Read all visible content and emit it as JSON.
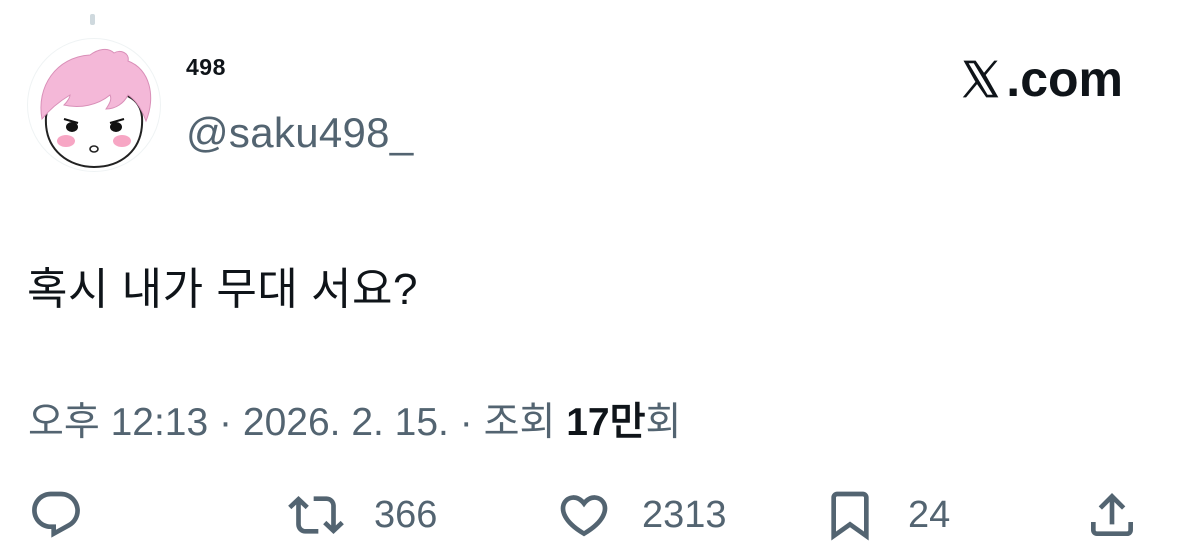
{
  "author": {
    "display_name": "498",
    "handle": "@saku498_"
  },
  "brand": {
    "name": ".com",
    "logo": "x-logo-icon"
  },
  "tweet": {
    "text": "혹시 내가 무대 서요?"
  },
  "meta": {
    "time": "오후 12:13",
    "separator": "·",
    "date": "2026. 2. 15.",
    "views_label": "조회",
    "views_number": "17만",
    "views_suffix": "회"
  },
  "actions": {
    "reply": {
      "icon": "reply-icon"
    },
    "retweet": {
      "icon": "retweet-icon",
      "count": "366"
    },
    "like": {
      "icon": "heart-icon",
      "count": "2313"
    },
    "bookmark": {
      "icon": "bookmark-icon",
      "count": "24"
    },
    "share": {
      "icon": "share-icon"
    }
  },
  "colors": {
    "text_primary": "#0f1419",
    "text_secondary": "#536471",
    "avatar_hair": "#f4b8d8",
    "avatar_cheek": "#f7a6c4"
  }
}
